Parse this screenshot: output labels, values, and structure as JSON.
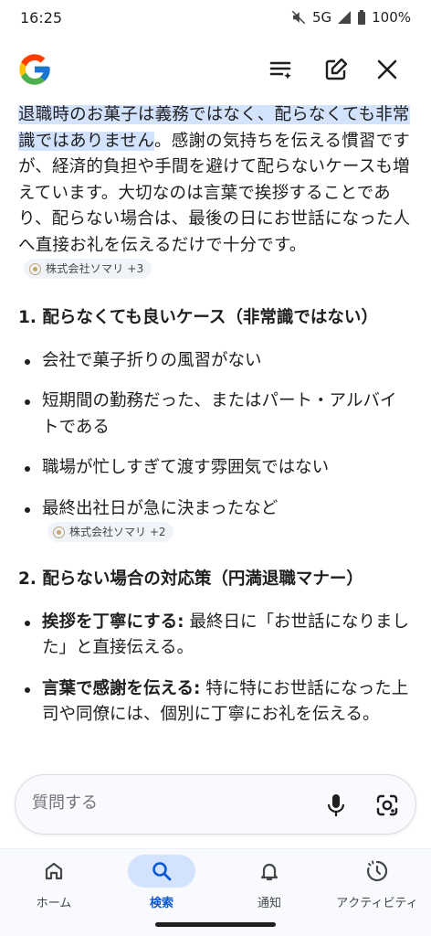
{
  "status": {
    "time": "16:25",
    "network": "5G",
    "battery": "100%"
  },
  "appbar": {
    "logo": "google-g-logo",
    "icons": [
      "filter-list-icon",
      "edit-icon",
      "close-icon"
    ]
  },
  "content": {
    "intro_highlight": "退職時のお菓子は義務ではなく、配らなくても非常識ではありません",
    "intro_rest": "。感謝の気持ちを伝える慣習ですが、経済的負担や手間を避けて配らないケースも増えています。大切なのは言葉で挨拶することであり、配らない場合は、最後の日にお世話になった人へ直接お礼を伝えるだけで十分です。",
    "intro_chip": "株式会社ソマリ +3",
    "section1_title": "1. 配らなくても良いケース（非常識ではない）",
    "section1_items": [
      "会社で菓子折りの風習がない",
      "短期間の勤務だった、またはパート・アルバイトである",
      "職場が忙しすぎて渡す雰囲気ではない",
      "最終出社日が急に決まったなど"
    ],
    "section1_chip": "株式会社ソマリ +2",
    "section2_title": "2. 配らない場合の対応策（円満退職マナー）",
    "section2_items": [
      {
        "bold": "挨拶を丁寧にする:",
        "text": " 最終日に「お世話になりました」と直接伝える。"
      },
      {
        "bold": "言葉で感謝を伝える:",
        "text": " 特に特にお世話になった上司や同僚には、個別に丁寧にお礼を伝える。"
      }
    ]
  },
  "askbar": {
    "placeholder": "質問する"
  },
  "nav": {
    "items": [
      {
        "label": "ホーム",
        "icon": "home-icon"
      },
      {
        "label": "検索",
        "icon": "search-icon",
        "active": true
      },
      {
        "label": "通知",
        "icon": "bell-icon"
      },
      {
        "label": "アクティビティ",
        "icon": "activity-icon"
      }
    ]
  },
  "colors": {
    "accent": "#0b57d0",
    "highlight": "#d3e3fd"
  }
}
